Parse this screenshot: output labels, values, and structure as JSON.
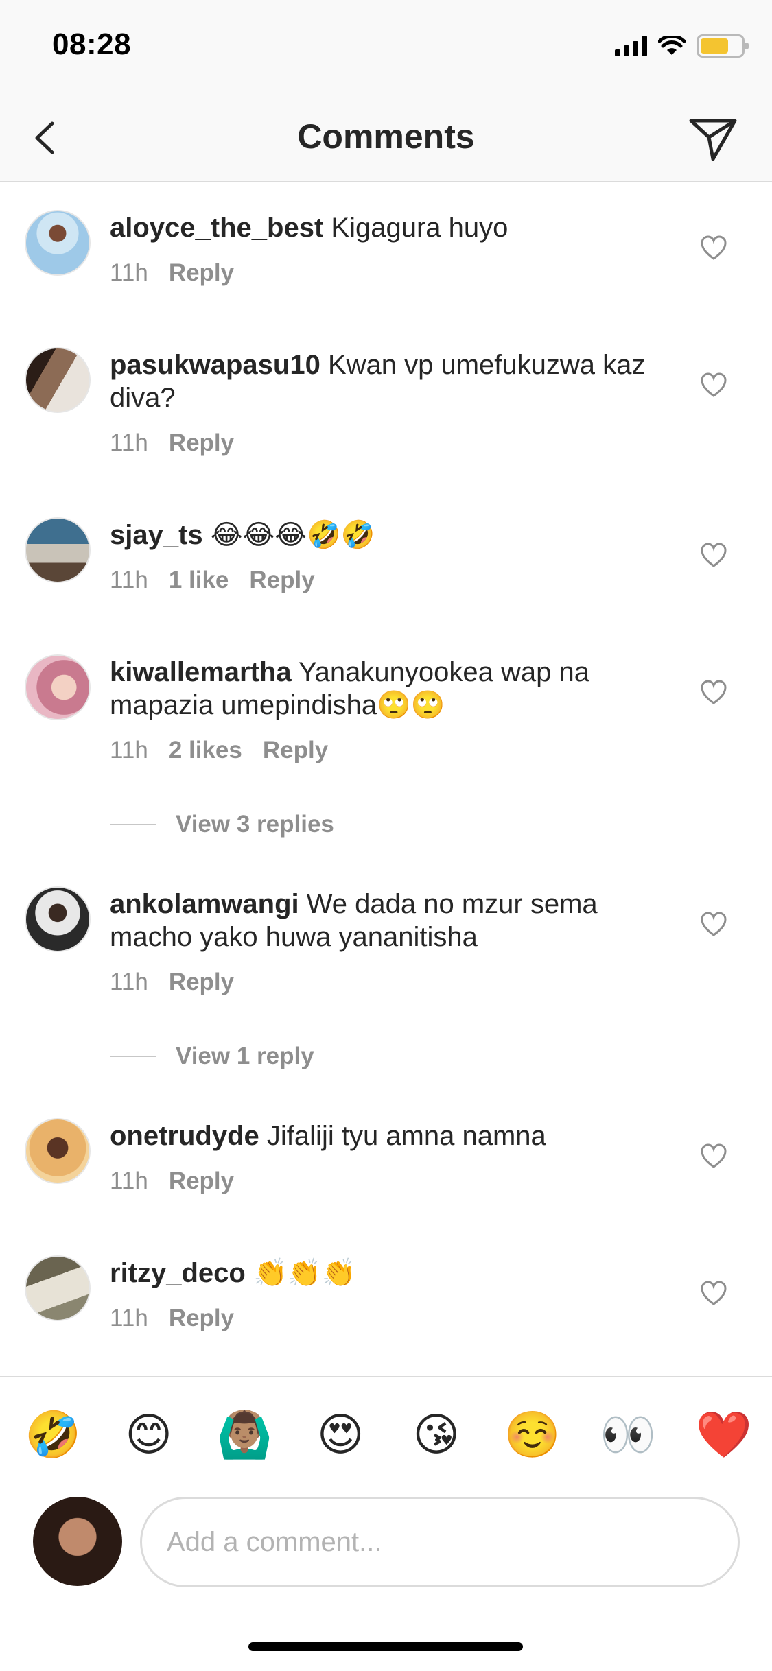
{
  "status_bar": {
    "time": "08:28"
  },
  "header": {
    "title": "Comments"
  },
  "comments": [
    {
      "username": "aloyce_the_best",
      "text": "Kigagura huyo",
      "time": "11h",
      "likes": "",
      "reply_label": "Reply"
    },
    {
      "username": "pasukwapasu10",
      "text": "Kwan vp umefukuzwa kaz diva?",
      "time": "11h",
      "likes": "",
      "reply_label": "Reply"
    },
    {
      "username": "sjay_ts",
      "text": "😂😂😂🤣🤣",
      "time": "11h",
      "likes": "1 like",
      "reply_label": "Reply"
    },
    {
      "username": "kiwallemartha",
      "text": "Yanakunyookea wap na mapazia umepindisha🙄🙄",
      "time": "11h",
      "likes": "2 likes",
      "reply_label": "Reply",
      "view_replies": "View 3 replies"
    },
    {
      "username": "ankolamwangi",
      "text": "We dada no mzur sema macho yako huwa yananitisha",
      "time": "11h",
      "likes": "",
      "reply_label": "Reply",
      "view_replies": "View 1 reply"
    },
    {
      "username": "onetrudyde",
      "text": "Jifaliji tyu amna namna",
      "time": "11h",
      "likes": "",
      "reply_label": "Reply"
    },
    {
      "username": "ritzy_deco",
      "text": "👏👏👏",
      "time": "11h",
      "likes": "",
      "reply_label": "Reply"
    }
  ],
  "quick_reactions": [
    "🤣",
    "😊",
    "🙆🏽‍♂️",
    "😍",
    "😘",
    "☺️",
    "👀",
    "❤️"
  ],
  "composer": {
    "placeholder": "Add a comment..."
  },
  "colors": {
    "text": "#262626",
    "secondary": "#8e8e8e",
    "border": "#dbdbdb",
    "battery": "#f4c430"
  }
}
